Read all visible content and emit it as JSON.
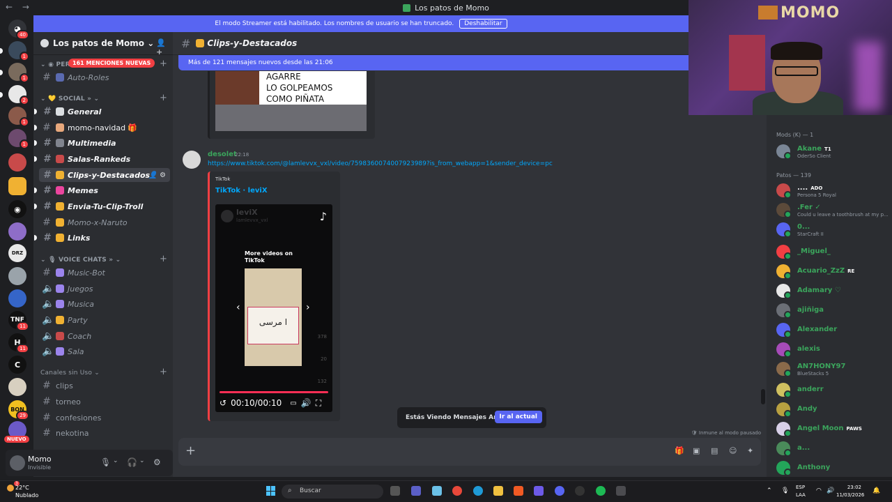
{
  "window": {
    "title": "Los patos de Momo"
  },
  "streamer_banner": {
    "text": "El modo Streamer está habilitado. Los nombres de usuario se han truncado.",
    "button": "Deshabilitar"
  },
  "server_rail": {
    "badges": [
      "40",
      "1",
      "1",
      "2",
      "1",
      "1",
      "11",
      "11",
      "29"
    ],
    "new_label": "NUEVO"
  },
  "sidebar": {
    "guild_name": "Los patos de Momo ⌄",
    "mentions_pill": "161 MENCIONES NUEVAS",
    "category_top_partial": "PER",
    "categories": {
      "social": "SOCIAL »",
      "voice": "VOICE CHATS »",
      "no_use": "Canales sin Uso"
    },
    "channels": [
      {
        "label": "Auto-Roles"
      },
      {
        "label": "General"
      },
      {
        "label": "momo-navidad"
      },
      {
        "label": "Multimedia"
      },
      {
        "label": "Salas-Rankeds"
      },
      {
        "label": "Clips-y-Destacados"
      },
      {
        "label": "Memes"
      },
      {
        "label": "Envia-Tu-Clip-Troll"
      },
      {
        "label": "Momo-x-Naruto"
      },
      {
        "label": "Links"
      },
      {
        "label": "Music-Bot"
      },
      {
        "label": "Juegos"
      },
      {
        "label": "Musica"
      },
      {
        "label": "Party"
      },
      {
        "label": "Coach"
      },
      {
        "label": "Sala"
      },
      {
        "label": "clips"
      },
      {
        "label": "torneo"
      },
      {
        "label": "confesiones"
      },
      {
        "label": "nekotina"
      }
    ]
  },
  "user_panel": {
    "name": "Momo",
    "status": "Invisible"
  },
  "channel_header": {
    "name": "Clips-y-Destacados"
  },
  "new_messages_bar": "Más de 121 mensajes nuevos desde las 21:06",
  "previous_embed": {
    "lines": [
      "AGARRE",
      "LO GOLPEAMOS",
      "COMO PIÑATA"
    ]
  },
  "message": {
    "author": "desolet",
    "time": "22:18",
    "link": "https://www.tiktok.com/@lamlevvx_vxl/video/7598360074007923989?is_from_webapp=1&sender_device=pc",
    "embed_provider": "TikTok",
    "embed_title": "TikTok · leviX"
  },
  "tiktok_player": {
    "author": "leviX",
    "handle": "lamlevvx_vxl",
    "more_videos": "More videos on TikTok",
    "time": "00:10/00:10",
    "counts": [
      "378",
      "20",
      "132"
    ]
  },
  "jump_bar": {
    "text": "Estás Viendo Mensajes Antiguos",
    "button": "Ir al actual"
  },
  "immune_note": "Inmune al modo pausado",
  "members": {
    "group_mods": "Mods (K) — 1",
    "group_patos": "Patos — 139",
    "list": [
      {
        "name": "Akane",
        "tag": "T1",
        "sub": "OderSo Client"
      },
      {
        "name": "....",
        "tag": "ADO",
        "sub": "Persona 5 Royal"
      },
      {
        "name": ".Fer ✓",
        "tag": "",
        "sub": "Could u leave a toothbrush at my p..."
      },
      {
        "name": "0...",
        "tag": "",
        "sub": "StarCraft II"
      },
      {
        "name": "_Miguel_",
        "tag": "",
        "sub": ""
      },
      {
        "name": "Acuario_ZzZ",
        "tag": "RE",
        "sub": ""
      },
      {
        "name": "Adamary ♡",
        "tag": "",
        "sub": ""
      },
      {
        "name": "ajiñiga",
        "tag": "",
        "sub": ""
      },
      {
        "name": "Alexander",
        "tag": "",
        "sub": ""
      },
      {
        "name": "alexis",
        "tag": "",
        "sub": ""
      },
      {
        "name": "AN7HONY97",
        "tag": "",
        "sub": "BlueStacks 5"
      },
      {
        "name": "anderr",
        "tag": "",
        "sub": ""
      },
      {
        "name": "Andy",
        "tag": "",
        "sub": ""
      },
      {
        "name": "Angel Moon",
        "tag": "PAWS",
        "sub": ""
      },
      {
        "name": "a...",
        "tag": "",
        "sub": ""
      },
      {
        "name": "Anthony",
        "tag": "",
        "sub": ""
      }
    ]
  },
  "webcam": {
    "sign": "MOMO"
  },
  "taskbar": {
    "weather_temp": "22°C",
    "weather_text": "Nublado",
    "weather_badge": "3",
    "search_placeholder": "Buscar",
    "lang": "ESP",
    "lang_sub": "LAA",
    "time": "23:02",
    "date": "11/03/2026"
  }
}
